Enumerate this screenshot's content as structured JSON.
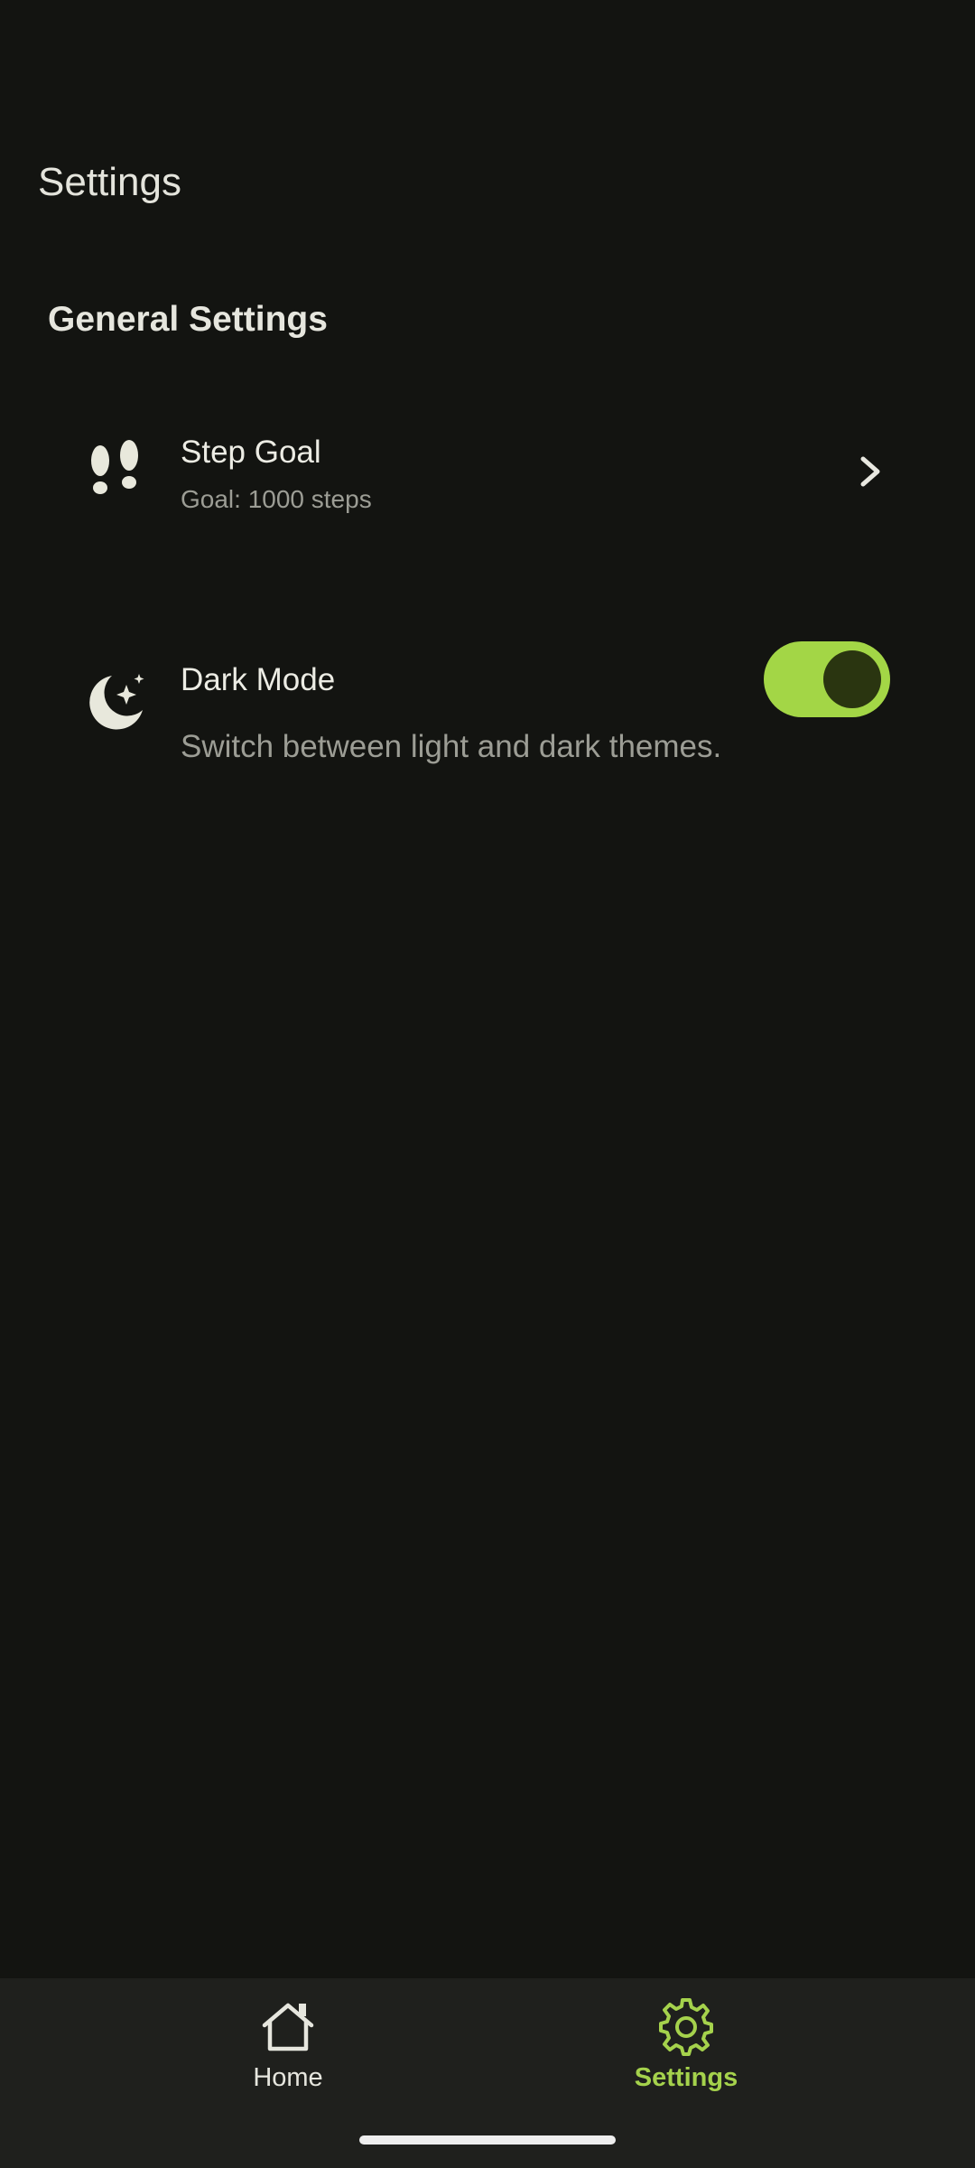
{
  "header": {
    "title": "Settings"
  },
  "section": {
    "title": "General Settings"
  },
  "settings": {
    "step_goal": {
      "icon": "footprints-icon",
      "title": "Step Goal",
      "subtitle": "Goal: 1000 steps"
    },
    "dark_mode": {
      "icon": "moon-stars-icon",
      "title": "Dark Mode",
      "subtitle": "Switch between light and dark themes.",
      "enabled": true
    }
  },
  "bottom_nav": {
    "items": [
      {
        "label": "Home",
        "icon": "home-icon",
        "active": false
      },
      {
        "label": "Settings",
        "icon": "gear-icon",
        "active": true
      }
    ]
  },
  "colors": {
    "background": "#131411",
    "accent": "#a3d646",
    "nav_background": "#1f201d",
    "toggle_knob": "#2a3510"
  }
}
